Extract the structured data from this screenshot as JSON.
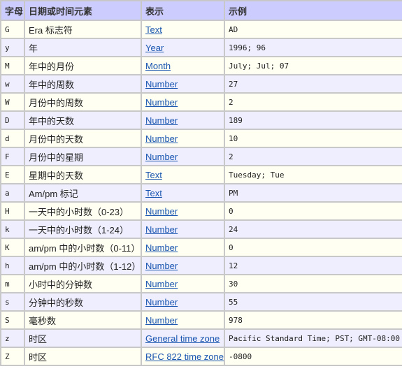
{
  "table": {
    "headers": [
      "字母",
      "日期或时间元素",
      "表示",
      "示例"
    ],
    "rows": [
      {
        "letter": "G",
        "element": "Era 标志符",
        "presentation": "Text",
        "example": "AD"
      },
      {
        "letter": "y",
        "element": "年",
        "presentation": "Year",
        "example": "1996; 96"
      },
      {
        "letter": "M",
        "element": "年中的月份",
        "presentation": "Month",
        "example": "July; Jul; 07"
      },
      {
        "letter": "w",
        "element": "年中的周数",
        "presentation": "Number",
        "example": "27"
      },
      {
        "letter": "W",
        "element": "月份中的周数",
        "presentation": "Number",
        "example": "2"
      },
      {
        "letter": "D",
        "element": "年中的天数",
        "presentation": "Number",
        "example": "189"
      },
      {
        "letter": "d",
        "element": "月份中的天数",
        "presentation": "Number",
        "example": "10"
      },
      {
        "letter": "F",
        "element": "月份中的星期",
        "presentation": "Number",
        "example": "2"
      },
      {
        "letter": "E",
        "element": "星期中的天数",
        "presentation": "Text",
        "example": "Tuesday; Tue"
      },
      {
        "letter": "a",
        "element": "Am/pm 标记",
        "presentation": "Text",
        "example": "PM"
      },
      {
        "letter": "H",
        "element": "一天中的小时数（0-23）",
        "presentation": "Number",
        "example": "0"
      },
      {
        "letter": "k",
        "element": "一天中的小时数（1-24）",
        "presentation": "Number",
        "example": "24"
      },
      {
        "letter": "K",
        "element": "am/pm 中的小时数（0-11）",
        "presentation": "Number",
        "example": "0"
      },
      {
        "letter": "h",
        "element": "am/pm 中的小时数（1-12）",
        "presentation": "Number",
        "example": "12"
      },
      {
        "letter": "m",
        "element": "小时中的分钟数",
        "presentation": "Number",
        "example": "30"
      },
      {
        "letter": "s",
        "element": "分钟中的秒数",
        "presentation": "Number",
        "example": "55"
      },
      {
        "letter": "S",
        "element": "毫秒数",
        "presentation": "Number",
        "example": "978"
      },
      {
        "letter": "z",
        "element": "时区",
        "presentation": "General time zone",
        "example": "Pacific Standard Time; PST; GMT-08:00"
      },
      {
        "letter": "Z",
        "element": "时区",
        "presentation": "RFC 822 time zone",
        "example": "-0800"
      }
    ]
  },
  "colors": {
    "header_bg": "#ccccff",
    "row_odd_bg": "#fffff2",
    "row_even_bg": "#eeeeff",
    "border": "#c8c8c8",
    "link": "#1a56b0"
  }
}
